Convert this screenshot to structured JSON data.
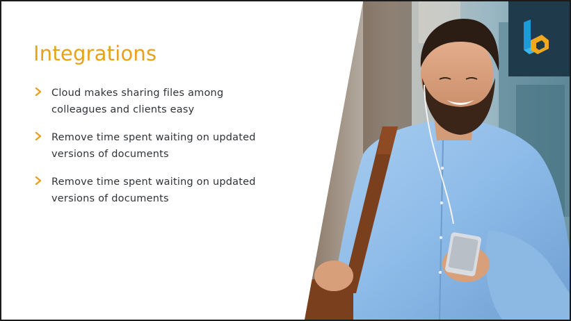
{
  "slide": {
    "title": "Integrations",
    "bullets": [
      {
        "line1": "Cloud makes sharing files among",
        "line2": "colleagues and clients easy"
      },
      {
        "line1": "Remove time spent waiting on updated",
        "line2": "versions of documents"
      },
      {
        "line1": "Remove time spent waiting on updated",
        "line2": "versions of documents"
      }
    ]
  },
  "colors": {
    "accent": "#e7a21a",
    "text": "#2f3338",
    "logo_bg": "#1f3a4a",
    "logo_blue": "#1e9ad6",
    "logo_gold": "#f0a81c"
  },
  "icons": {
    "bullet": "chevron-right-icon",
    "brand": "brand-logo-icon"
  }
}
